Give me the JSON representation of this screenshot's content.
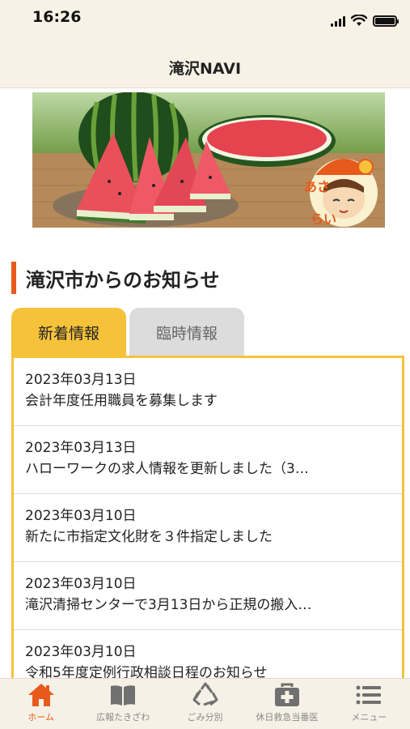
{
  "status_bar": {
    "time": "16:26"
  },
  "header": {
    "title": "滝沢NAVI"
  },
  "banner": {
    "character_text": "あさらい"
  },
  "section": {
    "title": "滝沢市からのお知らせ"
  },
  "tabs": [
    {
      "label": "新着情報",
      "active": true
    },
    {
      "label": "臨時情報",
      "active": false
    }
  ],
  "news": [
    {
      "date": "2023年03月13日",
      "title": "会計年度任用職員を募集します"
    },
    {
      "date": "2023年03月13日",
      "title": "ハローワークの求人情報を更新しました（3…"
    },
    {
      "date": "2023年03月10日",
      "title": "新たに市指定文化財を３件指定しました"
    },
    {
      "date": "2023年03月10日",
      "title": "滝沢清掃センターで3月13日から正規の搬入…"
    },
    {
      "date": "2023年03月10日",
      "title": "令和5年度定例行政相談日程のお知らせ"
    }
  ],
  "bottom_nav": [
    {
      "label": "ホーム",
      "icon": "home-icon",
      "active": true
    },
    {
      "label": "広報たきざわ",
      "icon": "book-icon",
      "active": false
    },
    {
      "label": "ごみ分別",
      "icon": "recycle-icon",
      "active": false
    },
    {
      "label": "休日救急当番医",
      "icon": "medical-kit-icon",
      "active": false
    },
    {
      "label": "メニュー",
      "icon": "menu-icon",
      "active": false
    }
  ],
  "colors": {
    "accent": "#e8591c",
    "tab_active": "#f5c23a",
    "header_bg": "#f8f2e6"
  }
}
